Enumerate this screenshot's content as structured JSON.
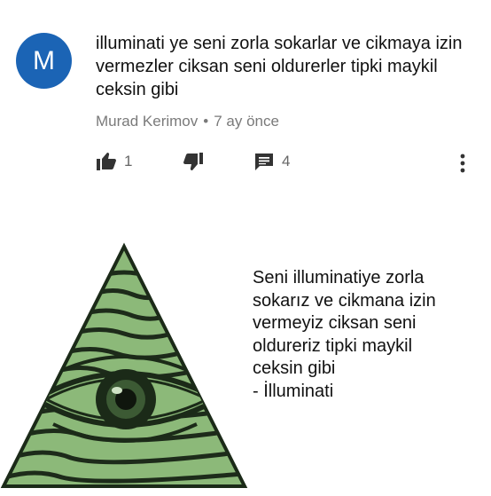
{
  "comment": {
    "avatar_letter": "M",
    "avatar_color": "#1b64b5",
    "text": "illuminati ye seni zorla sokarlar ve cikmaya izin vermezler ciksan seni oldurerler tipki maykil ceksin gibi",
    "author": "Murad Kerimov",
    "separator": "•",
    "time": "7 ay önce",
    "likes": "1",
    "replies": "4",
    "icons": {
      "like": "thumbs-up-icon",
      "dislike": "thumbs-down-icon",
      "reply": "comment-icon",
      "more": "more-vert-icon"
    }
  },
  "meme": {
    "image": "illuminati-eye-triangle",
    "triangle_color": "#8cb979",
    "quote_lines": [
      "Seni illuminatiye zorla",
      "sokarız ve cikmana izin",
      "vermeyiz ciksan seni",
      "oldureriz tipki maykil",
      "ceksin gibi",
      "- İlluminati"
    ]
  }
}
